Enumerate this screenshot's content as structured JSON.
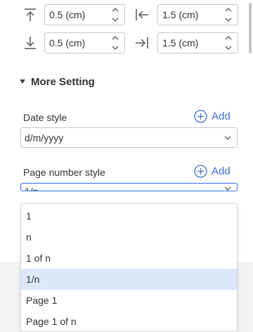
{
  "margins": {
    "top": {
      "value": "0.5 (cm)"
    },
    "left": {
      "value": "1.5 (cm)"
    },
    "bottom": {
      "value": "0.5 (cm)"
    },
    "right": {
      "value": "1.5 (cm)"
    }
  },
  "more_setting": {
    "title": "More Setting"
  },
  "date_style": {
    "label": "Date style",
    "add_label": "Add",
    "value": "d/m/yyyy"
  },
  "page_number_style": {
    "label": "Page number style",
    "add_label": "Add",
    "value": "1/n",
    "options": [
      "1",
      "n",
      "1 of n",
      "1/n",
      "Page 1",
      "Page 1 of n"
    ],
    "selected_index": 3
  },
  "colors": {
    "accent": "#2f6fe4",
    "selected_bg": "#dde8fb"
  }
}
